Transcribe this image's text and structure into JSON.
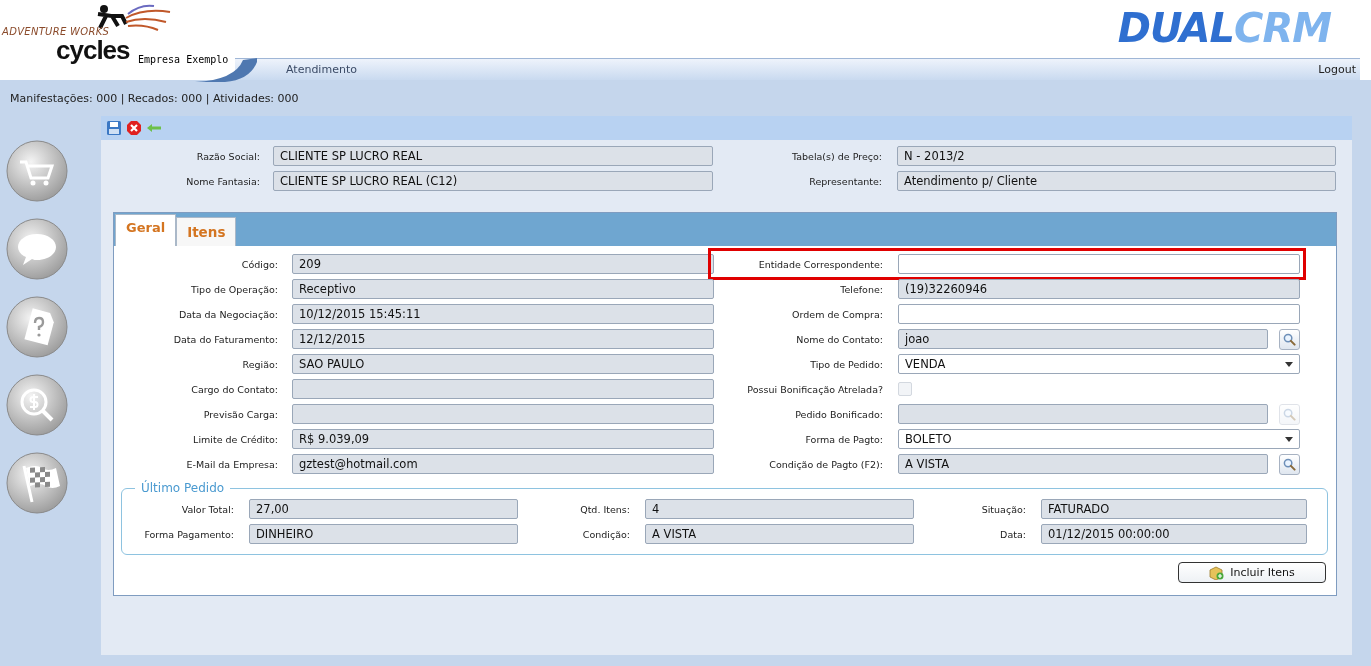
{
  "header": {
    "brand_tagline": "ADVENTURE WORKS",
    "brand_name": "cycles",
    "company": "Empresa Exemplo",
    "product_logo": {
      "part_1": "DUAL",
      "part_2": "CRM"
    },
    "nav": [
      {
        "label": "Atendimento"
      }
    ],
    "logout": "Logout"
  },
  "counters": "Manifestações: 000 | Recados: 000 | Atividades: 000",
  "header_fields": {
    "left": [
      {
        "label": "Razão Social:",
        "value": "CLIENTE SP LUCRO REAL",
        "kind": "text",
        "disabled": true
      },
      {
        "label": "Nome Fantasia:",
        "value": "CLIENTE SP LUCRO REAL (C12)",
        "kind": "text",
        "disabled": true
      }
    ],
    "right": [
      {
        "label": "Tabela(s) de Preço:",
        "value": "N - 2013/2",
        "kind": "text",
        "disabled": true
      },
      {
        "label": "Representante:",
        "value": "Atendimento p/ Cliente",
        "kind": "text",
        "disabled": true
      }
    ]
  },
  "tabs": [
    {
      "label": "Geral",
      "selected": true
    },
    {
      "label": "Itens",
      "selected": false
    }
  ],
  "form": {
    "left": [
      {
        "label": "Código:",
        "value": "209",
        "kind": "text",
        "disabled": true
      },
      {
        "label": "Tipo de Operação:",
        "value": "Receptivo",
        "kind": "text",
        "disabled": true
      },
      {
        "label": "Data da Negociação:",
        "value": "10/12/2015 15:45:11",
        "kind": "text",
        "disabled": true
      },
      {
        "label": "Data do Faturamento:",
        "value": "12/12/2015",
        "kind": "text",
        "disabled": true
      },
      {
        "label": "Região:",
        "value": "SAO PAULO",
        "kind": "text",
        "disabled": true
      },
      {
        "label": "Cargo do Contato:",
        "kind": "text",
        "disabled": true
      },
      {
        "label": "Previsão Carga:",
        "kind": "text",
        "disabled": true
      },
      {
        "label": "Limite de Crédito:",
        "value": "R$ 9.039,09",
        "kind": "text",
        "disabled": true
      },
      {
        "label": "E-Mail da Empresa:",
        "value": "gztest@hotmail.com",
        "kind": "text",
        "disabled": true
      }
    ],
    "right": [
      {
        "label": "Entidade Correspondente:",
        "kind": "text",
        "disabled": false,
        "highlighted": true
      },
      {
        "label": "Telefone:",
        "value": "(19)32260946",
        "kind": "text",
        "disabled": true
      },
      {
        "label": "Ordem de Compra:",
        "kind": "text",
        "disabled": false
      },
      {
        "label": "Nome do Contato:",
        "value": "joao",
        "kind": "lookup",
        "disabled": true,
        "button_disabled": false
      },
      {
        "label": "Tipo de Pedido:",
        "value": "VENDA",
        "kind": "select",
        "disabled": false
      },
      {
        "label": "Possui Bonificação Atrelada?",
        "kind": "checkbox",
        "checked": false,
        "disabled": true
      },
      {
        "label": "Pedido Bonificado:",
        "kind": "lookup",
        "disabled": true,
        "button_disabled": true
      },
      {
        "label": "Forma de Pagto:",
        "value": "BOLETO",
        "kind": "select",
        "disabled": false
      },
      {
        "label": "Condição de Pagto (F2):",
        "value": "A VISTA",
        "kind": "lookup",
        "disabled": true,
        "button_disabled": false
      }
    ]
  },
  "last_order": {
    "title": "Último Pedido",
    "fields": [
      {
        "label": "Valor Total:",
        "value": "27,00",
        "kind": "text",
        "disabled": true
      },
      {
        "label": "Qtd. Itens:",
        "value": "4",
        "kind": "text",
        "disabled": true
      },
      {
        "label": "Situação:",
        "value": "FATURADO",
        "kind": "text",
        "disabled": true
      },
      {
        "label": "Forma Pagamento:",
        "value": "DINHEIRO",
        "kind": "text",
        "disabled": true
      },
      {
        "label": "Condição:",
        "value": "A VISTA",
        "kind": "text",
        "disabled": true
      },
      {
        "label": "Data:",
        "value": "01/12/2015 00:00:00",
        "kind": "text",
        "disabled": true
      }
    ]
  },
  "add_items_button": "Incluir Itens"
}
